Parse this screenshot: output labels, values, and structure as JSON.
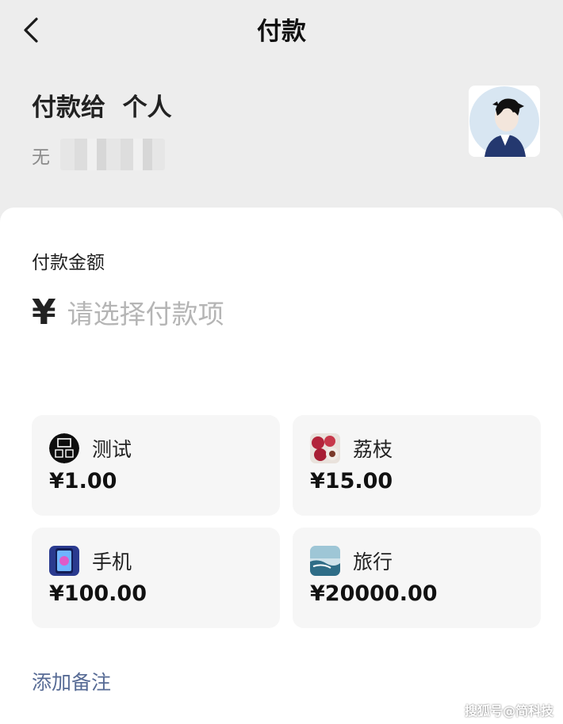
{
  "nav": {
    "title": "付款",
    "back_icon": "chevron-left-icon"
  },
  "payee": {
    "title": "付款给  个人",
    "name_visible": "无",
    "avatar": "user-avatar"
  },
  "payment": {
    "amount_label": "付款金额",
    "currency_symbol": "¥",
    "amount_placeholder": "请选择付款项"
  },
  "items": [
    {
      "name": "测试",
      "price": "¥1.00",
      "icon": "jian-keji-logo-icon"
    },
    {
      "name": "荔枝",
      "price": "¥15.00",
      "icon": "lychee-icon"
    },
    {
      "name": "手机",
      "price": "¥100.00",
      "icon": "smartphone-icon"
    },
    {
      "name": "旅行",
      "price": "¥20000.00",
      "icon": "sea-landscape-icon"
    }
  ],
  "remark": {
    "label": "添加备注"
  },
  "watermark": {
    "text": "搜狐号@简科技"
  },
  "colors": {
    "page_bg": "#ededed",
    "card_bg": "#ffffff",
    "tile_bg": "#f6f6f6",
    "link": "#576b95",
    "placeholder": "#b5b5b5"
  }
}
